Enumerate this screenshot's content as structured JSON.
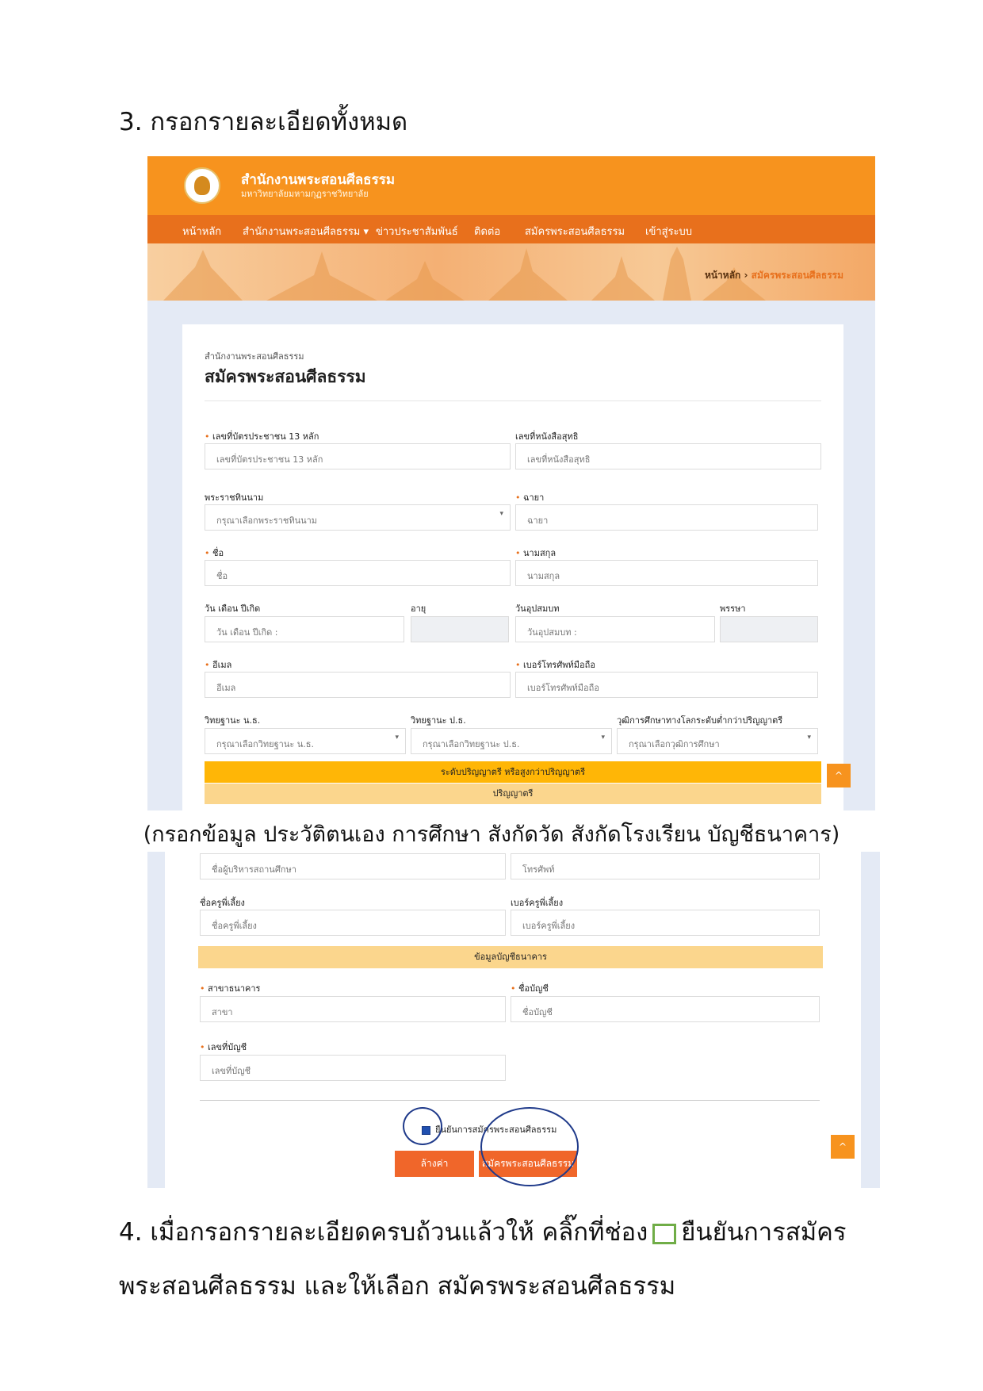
{
  "doc": {
    "step3": "3. กรอกรายละเอียดทั้งหมด",
    "caption": "(กรอกข้อมูล ประวัติตนเอง การศึกษา สังกัดวัด สังกัดโรงเรียน บัญชีธนาคาร)",
    "step4_part1": "4. เมื่อกรอกรายละเอียดครบถ้วนแล้วให้ คลิ๊กที่ช่อง",
    "step4_part2": "ยืนยันการสมัคร",
    "step4_line2": "พระสอนศีลธรรม และให้เลือก สมัครพระสอนศีลธรรม"
  },
  "site": {
    "title": "สำนักงานพระสอนศีลธรรม",
    "subtitle": "มหาวิทยาลัยมหามกุฏราชวิทยาลัย",
    "nav": [
      "หน้าหลัก",
      "สำนักงานพระสอนศีลธรรม ▾",
      "ข่าวประชาสัมพันธ์",
      "ติดต่อ",
      "สมัครพระสอนศีลธรรม",
      "เข้าสู่ระบบ"
    ],
    "breadcrumb_home": "หน้าหลัก",
    "breadcrumb_sep": "›",
    "breadcrumb_current": "สมัครพระสอนศีลธรรม"
  },
  "form": {
    "org": "สำนักงานพระสอนศีลธรรม",
    "heading": "สมัครพระสอนศีลธรรม",
    "id_label": "เลขที่บัตรประชาชน 13 หลัก",
    "id_ph": "เลขที่บัตรประชาชน 13 หลัก",
    "cert_label": "เลขที่หนังสือสุทธิ",
    "cert_ph": "เลขที่หนังสือสุทธิ",
    "title_label": "พระราชทินนาม",
    "title_ph": "กรุณาเลือกพระราชทินนาม",
    "monkname_label": "ฉายา",
    "monkname_ph": "ฉายา",
    "name_label": "ชื่อ",
    "name_ph": "ชื่อ",
    "surname_label": "นามสกุล",
    "surname_ph": "นามสกุล",
    "dob_label": "วัน เดือน ปีเกิด",
    "dob_ph": "วัน เดือน ปีเกิด :",
    "age_label": "อายุ",
    "ord_label": "วันอุปสมบท",
    "ord_ph": "วันอุปสมบท :",
    "vassa_label": "พรรษา",
    "email_label": "อีเมล",
    "email_ph": "อีเมล",
    "phone_label": "เบอร์โทรศัพท์มือถือ",
    "phone_ph": "เบอร์โทรศัพท์มือถือ",
    "nt_label": "วิทยฐานะ น.ธ.",
    "nt_ph": "กรุณาเลือกวิทยฐานะ น.ธ.",
    "pt_label": "วิทยฐานะ ป.ธ.",
    "pt_ph": "กรุณาเลือกวิทยฐานะ ป.ธ.",
    "edu_label": "วุฒิการศึกษาทางโลกระดับต่ำกว่าปริญญาตรี",
    "edu_ph": "กรุณาเลือกวุฒิการศึกษา",
    "bar_degree": "ระดับปริญญาตรี หรือสูงกว่าปริญญาตรี",
    "bar_bachelor": "ปริญญาตรี",
    "up": "^"
  },
  "form2": {
    "principal_ph": "ชื่อผู้บริหารสถานศึกษา",
    "tel_ph": "โทรศัพท์",
    "mentor_label": "ชื่อครูพี่เลี้ยง",
    "mentor_ph": "ชื่อครูพี่เลี้ยง",
    "mentor_tel_label": "เบอร์ครูพี่เลี้ยง",
    "mentor_tel_ph": "เบอร์ครูพี่เลี้ยง",
    "bank_bar": "ข้อมูลบัญชีธนาคาร",
    "branch_label": "สาขาธนาคาร",
    "branch_ph": "สาขา",
    "accname_label": "ชื่อบัญชี",
    "accname_ph": "ชื่อบัญชี",
    "accno_label": "เลขที่บัญชี",
    "accno_ph": "เลขที่บัญชี",
    "confirm": "ยืนยันการสมัครพระสอนศีลธรรม",
    "clear_btn": "ล้างค่า",
    "submit_btn": "สมัครพระสอนศีลธรรม",
    "up": "^"
  }
}
